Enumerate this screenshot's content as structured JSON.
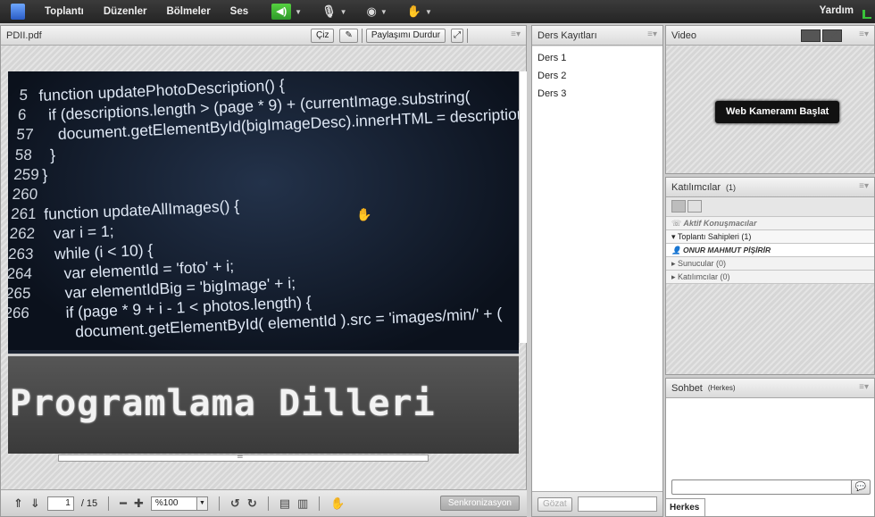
{
  "topbar": {
    "menus": [
      "Toplantı",
      "Düzenler",
      "Bölmeler",
      "Ses"
    ],
    "help": "Yardım"
  },
  "share_pod": {
    "title": "PDII.pdf",
    "draw_button": "Çiz",
    "stop_sharing_button": "Paylaşımı Durdur",
    "slide": {
      "line_numbers": [
        "5",
        "6",
        "57",
        "58",
        "259",
        "260",
        "261",
        "262",
        "263",
        "264",
        "265",
        "266"
      ],
      "code_lines": [
        "function updatePhotoDescription() {",
        "  if (descriptions.length > (page * 9) + (currentImage.substring(",
        "    document.getElementById(bigImageDesc).innerHTML = descriptions",
        "  }",
        "}",
        "",
        "function updateAllImages() {",
        "  var i = 1;",
        "  while (i < 10) {",
        "    var elementId = 'foto' + i;",
        "    var elementIdBig = 'bigImage' + i;",
        "    if (page * 9 + i - 1 < photos.length) {",
        "      document.getElementById( elementId ).src = 'images/min/' + ("
      ],
      "board_title": "Programlama Dilleri"
    },
    "controls": {
      "current_page": "1",
      "total_pages": "/ 15",
      "zoom": "%100",
      "sync_button": "Senkronizasyon"
    }
  },
  "records_pod": {
    "title": "Ders Kayıtları",
    "items": [
      "Ders 1",
      "Ders 2",
      "Ders 3"
    ],
    "browse_button": "Gözat"
  },
  "video_pod": {
    "title": "Video",
    "start_camera_button": "Web Kameramı Başlat"
  },
  "attendees_pod": {
    "title": "Katılımcılar",
    "count": "(1)",
    "active_speakers": "Aktif Konuşmacılar",
    "groups": [
      {
        "label": "Toplantı Sahipleri (1)",
        "expanded": true
      },
      {
        "label": "Sunucular (0)",
        "expanded": false
      },
      {
        "label": "Katılımcılar (0)",
        "expanded": false
      }
    ],
    "host_name": "ONUR MAHMUT PİŞİRİR"
  },
  "chat_pod": {
    "title": "Sohbet",
    "scope": "(Herkes)",
    "tab": "Herkes"
  },
  "colors": {
    "accent_green": "#39c33a",
    "topbar_bg": "#2e2e2e",
    "slide_bg": "#0f1724"
  }
}
